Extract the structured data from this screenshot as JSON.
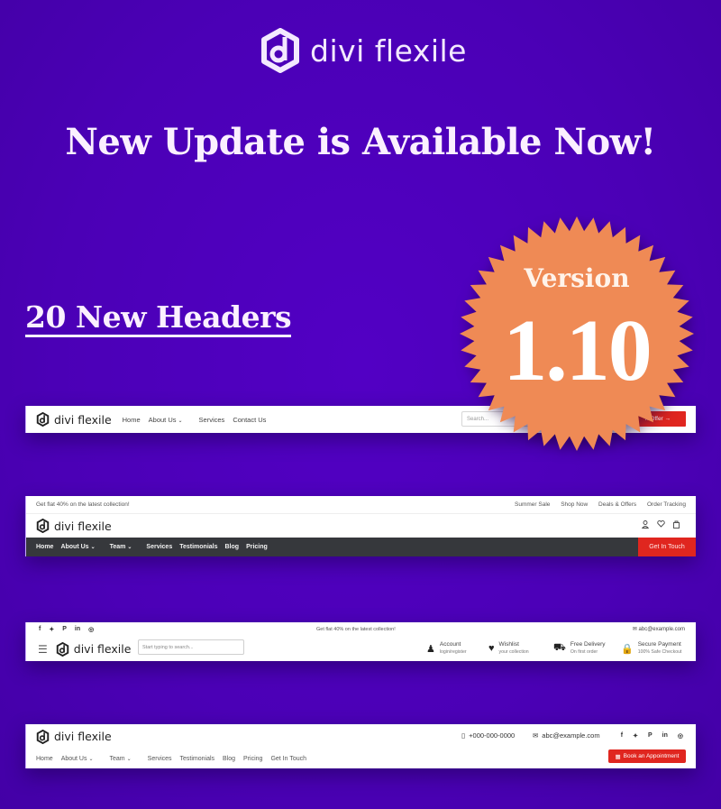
{
  "brand": {
    "name": "divi flexile",
    "logo_icon": "hexagon-d-logo-icon"
  },
  "headline": "New Update is Available Now!",
  "subheadline": "20 New Headers",
  "version_badge": {
    "label": "Version",
    "number": "1.10",
    "color": "#ef8a55"
  },
  "colors": {
    "background": "#4d00b8",
    "accent_red": "#e0261f",
    "dark_bar": "#36383c"
  },
  "header1": {
    "nav": [
      "Home",
      "About Us",
      "Services",
      "Contact Us"
    ],
    "search_placeholder": "Search...",
    "cta_label": "n Offer →"
  },
  "header2": {
    "promo": "Get flat 40% on the latest collection!",
    "top_links": [
      "Summer Sale",
      "Shop Now",
      "Deals & Offers",
      "Order Tracking"
    ],
    "icons": [
      "user-icon",
      "heart-icon",
      "bag-icon"
    ],
    "nav": [
      "Home",
      "About Us",
      "Team",
      "Services",
      "Testimonials",
      "Blog",
      "Pricing"
    ],
    "cta_label": "Get In Touch"
  },
  "header3": {
    "social": [
      "f",
      "t",
      "p",
      "in",
      "ig"
    ],
    "promo": "Get flat 40% on the latest collection!",
    "email": "abc@example.com",
    "search_placeholder": "Start typing to search...",
    "features": [
      {
        "icon": "account-icon",
        "title": "Account",
        "subtitle": "login/register"
      },
      {
        "icon": "wishlist-icon",
        "title": "Wishlist",
        "subtitle": "your collection"
      },
      {
        "icon": "delivery-truck-icon",
        "title": "Free Delivery",
        "subtitle": "On first order"
      },
      {
        "icon": "lock-icon",
        "title": "Secure Payment",
        "subtitle": "100% Safe Checkout"
      }
    ]
  },
  "header4": {
    "phone": "+000-000-0000",
    "email": "abc@example.com",
    "social": [
      "f",
      "t",
      "p",
      "in",
      "ig"
    ],
    "nav": [
      "Home",
      "About Us",
      "Team",
      "Services",
      "Testimonials",
      "Blog",
      "Pricing",
      "Get In Touch"
    ],
    "cta_label": "Book an Appointment"
  }
}
